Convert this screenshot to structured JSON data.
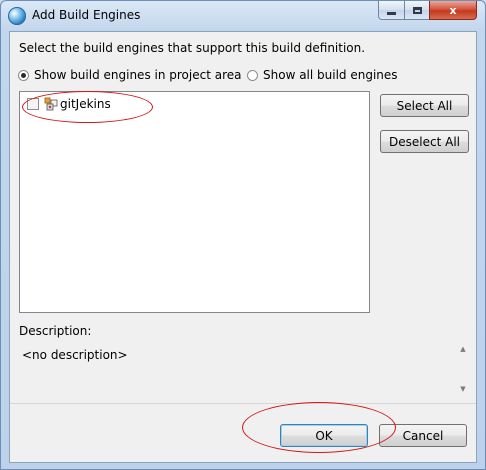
{
  "window": {
    "title": "Add Build Engines",
    "icon": "eclipse-globe-icon",
    "caption_buttons": [
      "minimize",
      "maximize",
      "close"
    ],
    "close_glyph": "x"
  },
  "dialog": {
    "instruction": "Select the build engines that support this build definition.",
    "scope_options": [
      {
        "label": "Show build engines in project area",
        "selected": true
      },
      {
        "label": "Show all build engines",
        "selected": false
      }
    ],
    "engines": [
      {
        "name": "gitJekins",
        "checked": false,
        "icon": "build-engine-icon"
      }
    ],
    "buttons": {
      "select_all": "Select All",
      "deselect_all": "Deselect All",
      "ok": "OK",
      "cancel": "Cancel"
    },
    "description": {
      "label": "Description:",
      "text": "<no description>"
    }
  },
  "annotations": [
    {
      "shape": "ellipse",
      "color": "#d01818",
      "target": "gitJekins"
    },
    {
      "shape": "ellipse",
      "color": "#d01818",
      "target": "OK"
    }
  ]
}
